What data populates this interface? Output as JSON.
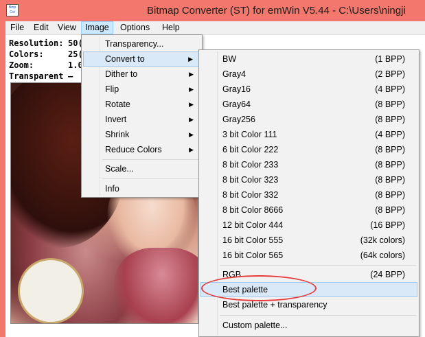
{
  "window": {
    "icon_text": [
      "Bmp",
      "Cvt"
    ],
    "title": "Bitmap Converter (ST) for emWin V5.44 - C:\\Users\\ningji"
  },
  "menubar": [
    "File",
    "Edit",
    "View",
    "Image",
    "Options",
    "Help"
  ],
  "info": {
    "resolution_label": "Resolution:",
    "resolution_value": "50(",
    "colors_label": "Colors:",
    "colors_value": "25(",
    "zoom_label": "Zoom:",
    "zoom_value": "1.0",
    "transparent_label": "Transparent",
    "transparent_value": "—"
  },
  "image_menu": {
    "transparency": "Transparency...",
    "convert_to": "Convert to",
    "dither_to": "Dither to",
    "flip": "Flip",
    "rotate": "Rotate",
    "invert": "Invert",
    "shrink": "Shrink",
    "reduce_colors": "Reduce Colors",
    "scale": "Scale...",
    "info": "Info"
  },
  "convert_menu": {
    "formats": [
      {
        "label": "BW",
        "depth": "(1 BPP)"
      },
      {
        "label": "Gray4",
        "depth": "(2 BPP)"
      },
      {
        "label": "Gray16",
        "depth": "(4 BPP)"
      },
      {
        "label": "Gray64",
        "depth": "(8 BPP)"
      },
      {
        "label": "Gray256",
        "depth": "(8 BPP)"
      },
      {
        "label": "3 bit Color 111",
        "depth": "(4 BPP)"
      },
      {
        "label": "6 bit Color 222",
        "depth": "(8 BPP)"
      },
      {
        "label": "8 bit Color 233",
        "depth": "(8 BPP)"
      },
      {
        "label": "8 bit Color 323",
        "depth": "(8 BPP)"
      },
      {
        "label": "8 bit Color 332",
        "depth": "(8 BPP)"
      },
      {
        "label": "8 bit Color 8666",
        "depth": "(8 BPP)"
      },
      {
        "label": "12 bit Color 444",
        "depth": "(16 BPP)"
      },
      {
        "label": "16 bit Color 555",
        "depth": "(32k colors)"
      },
      {
        "label": "16 bit Color 565",
        "depth": "(64k colors)"
      }
    ],
    "rgb": {
      "label": "RGB",
      "depth": "(24 BPP)"
    },
    "best_palette": "Best palette",
    "best_palette_transparency": "Best palette + transparency",
    "custom_palette": "Custom palette..."
  },
  "colors": {
    "titlebar": "#f3776c",
    "menu_highlight": "#d9e9f8",
    "annotation": "#e83c3c"
  }
}
